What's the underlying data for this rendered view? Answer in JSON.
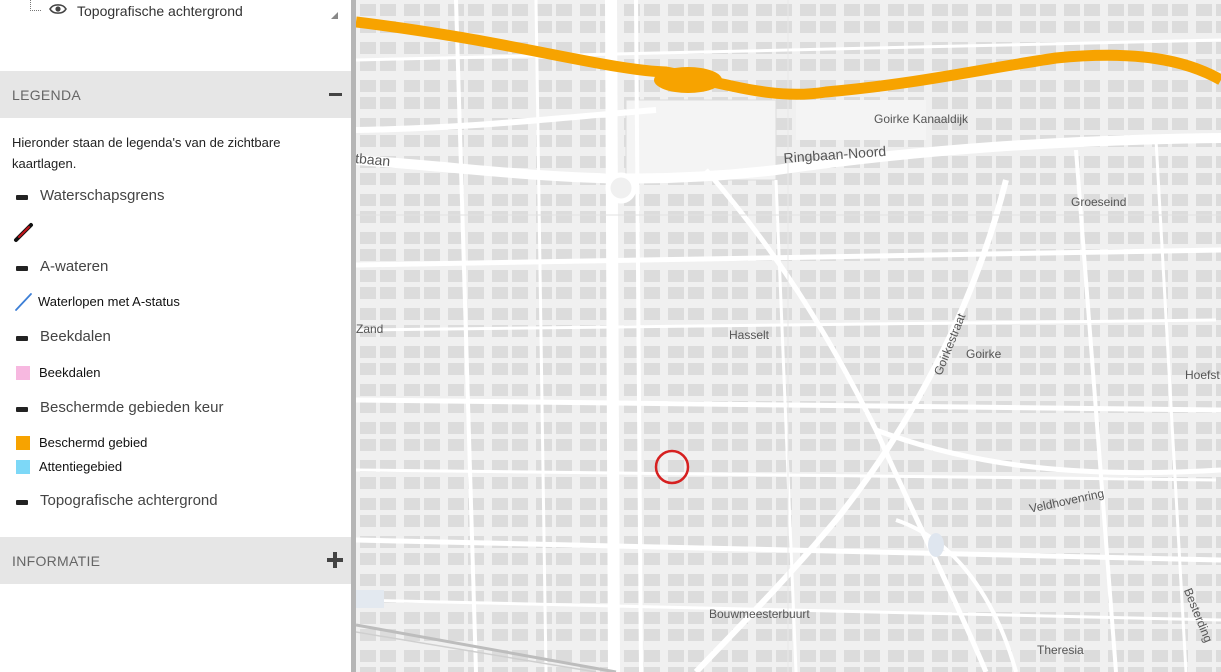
{
  "layer_tree": {
    "top_layer_label": "Topografische achtergrond"
  },
  "legend": {
    "header": "LEGENDA",
    "intro": "Hieronder staan de legenda's van de zichtbare kaartlagen.",
    "items": [
      {
        "kind": "group",
        "label": "Waterschapsgrens"
      },
      {
        "kind": "line",
        "label": "",
        "color": "#c0141a"
      },
      {
        "kind": "group",
        "label": "A-wateren"
      },
      {
        "kind": "line",
        "label": "Waterlopen met A-status",
        "color": "#3d7fd6"
      },
      {
        "kind": "group",
        "label": "Beekdalen"
      },
      {
        "kind": "fill",
        "label": "Beekdalen",
        "color": "#f7b8e0"
      },
      {
        "kind": "group",
        "label": "Beschermde gebieden keur"
      },
      {
        "kind": "fill",
        "label": "Beschermd gebied",
        "color": "#f7a300"
      },
      {
        "kind": "fill",
        "label": "Attentiegebied",
        "color": "#7dd8f7"
      },
      {
        "kind": "group",
        "label": "Topografische achtergrond"
      }
    ]
  },
  "informatie": {
    "header": "INFORMATIE"
  },
  "map": {
    "labels": {
      "goirke_kanaaldijk": "Goirke Kanaaldijk",
      "ringbaan_noord": "Ringbaan-Noord",
      "ringbaan_west_partial": "tbaan",
      "groeseind": "Groeseind",
      "zand_partial": "Zand",
      "hasselt": "Hasselt",
      "goirkestraat": "Goirkestraat",
      "goirke": "Goirke",
      "hoefstraat_partial": "Hoefst",
      "veldhovenring": "Veldhovenring",
      "bouwmeesterbuurt": "Bouwmeesterbuurt",
      "besterding": "Besterding",
      "theresia": "Theresia"
    },
    "colors": {
      "protected_area": "#f7a300",
      "location_marker": "#d62020",
      "background": "#f0f0f0",
      "roads": "#ffffff",
      "buildings": "#dcdcdc"
    }
  }
}
